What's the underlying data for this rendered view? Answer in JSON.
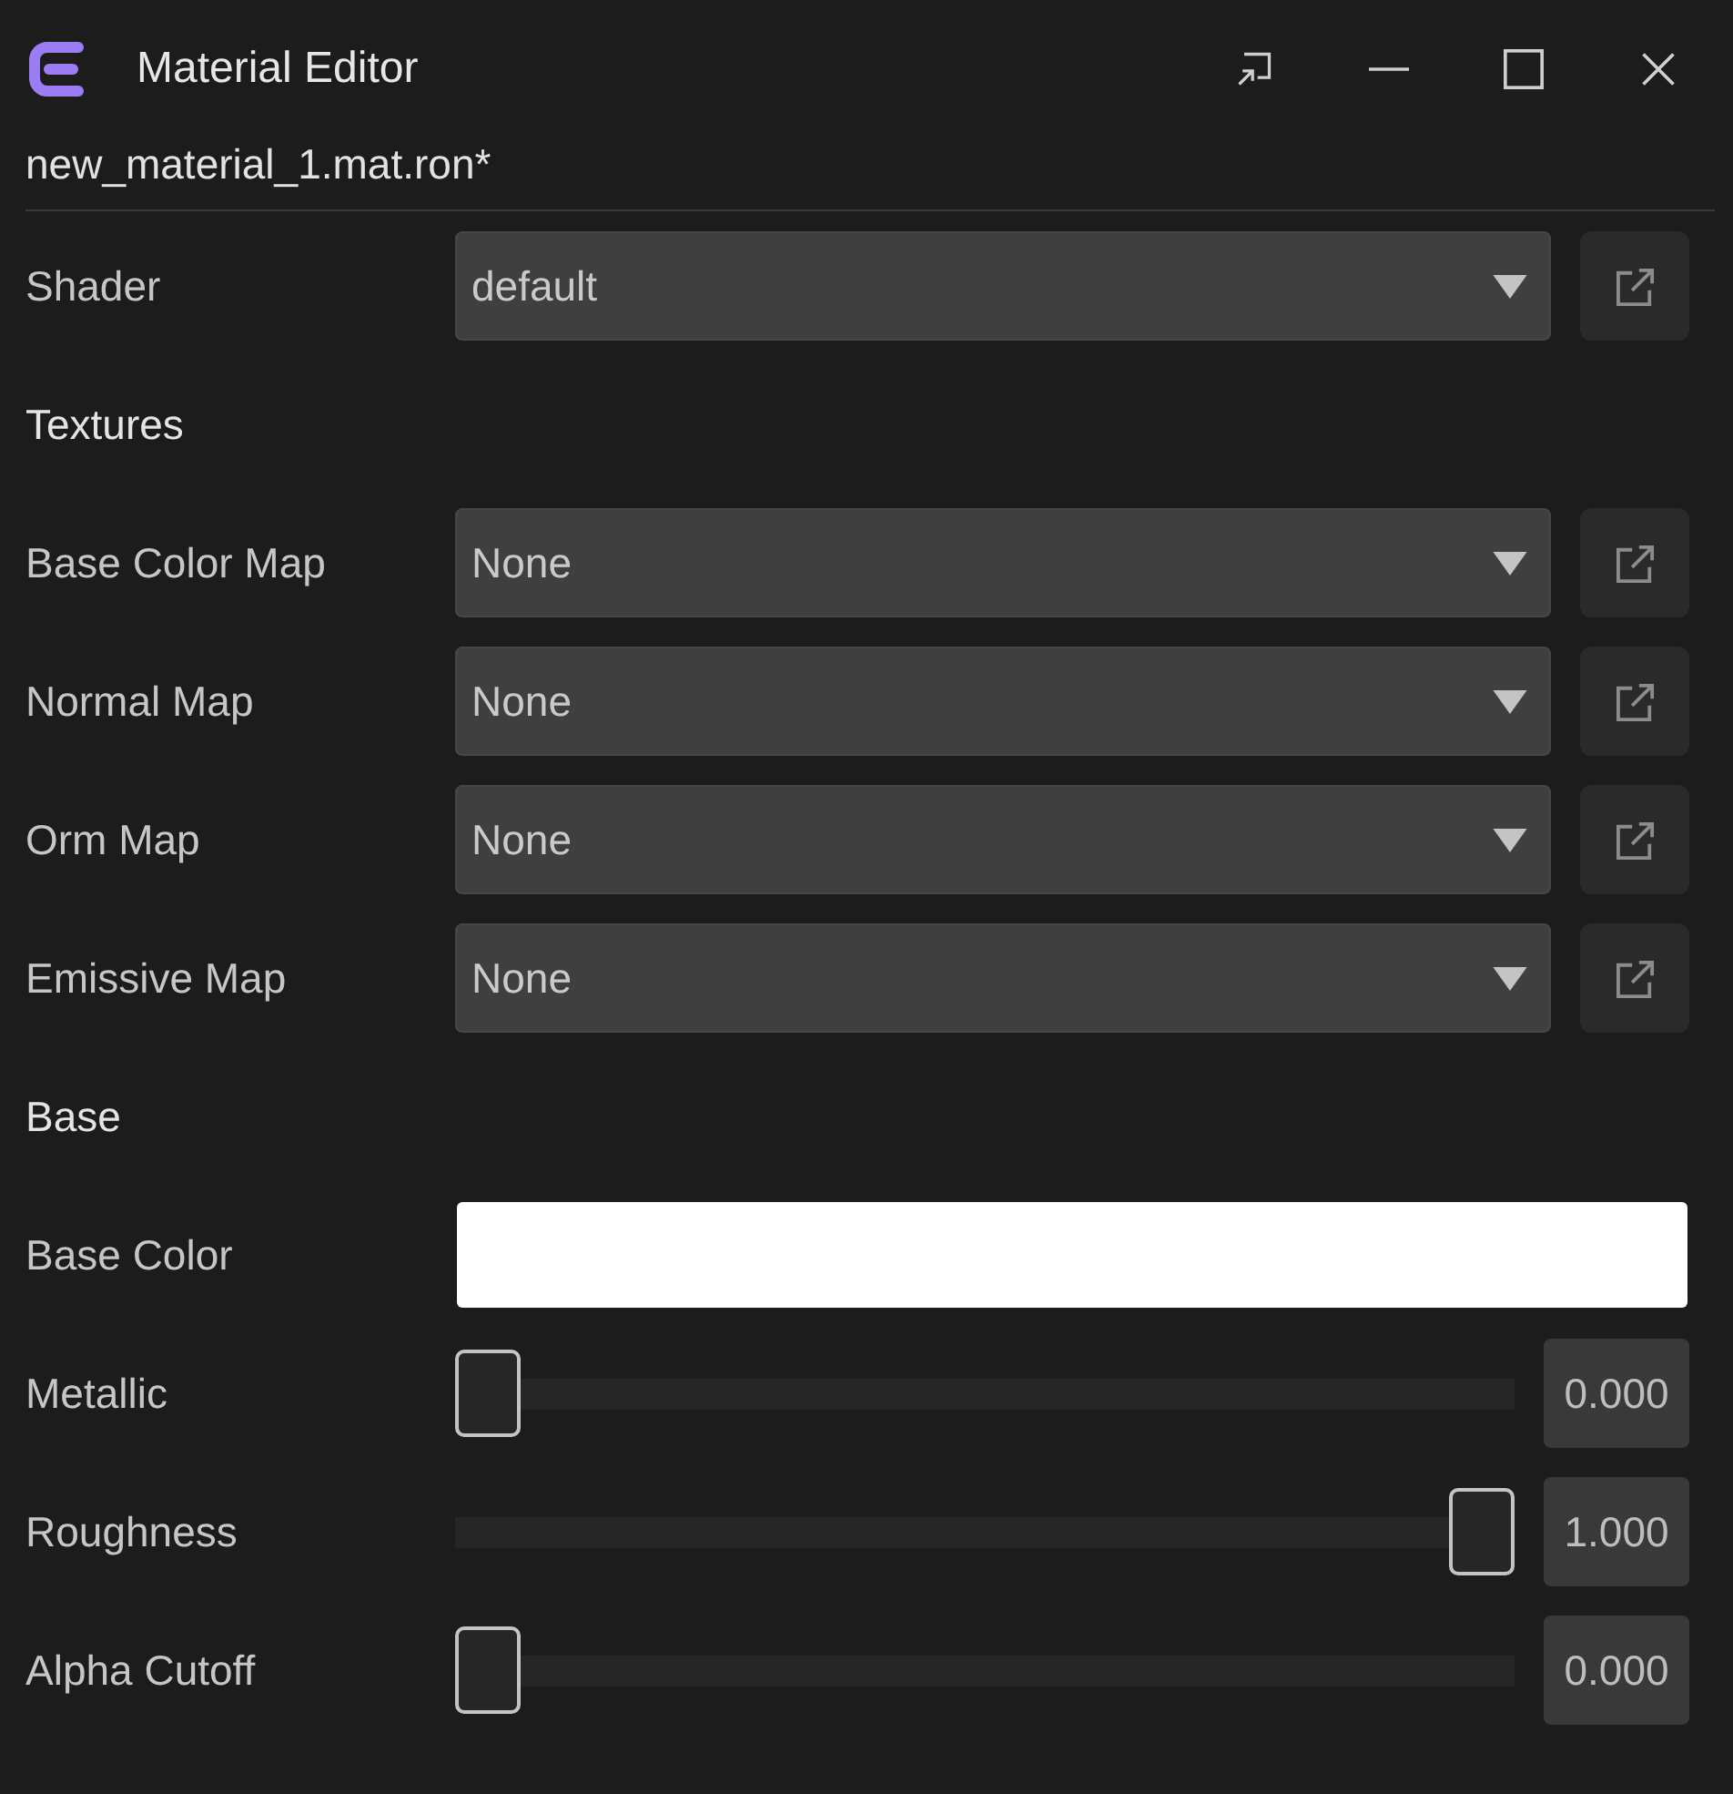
{
  "window": {
    "title": "Material Editor",
    "file": "new_material_1.mat.ron*"
  },
  "rows": [
    {
      "kind": "dropdown",
      "label": "Shader",
      "value": "default"
    },
    {
      "kind": "heading",
      "label": "Textures"
    },
    {
      "kind": "dropdown",
      "label": "Base Color Map",
      "value": "None"
    },
    {
      "kind": "dropdown",
      "label": "Normal Map",
      "value": "None"
    },
    {
      "kind": "dropdown",
      "label": "Orm Map",
      "value": "None"
    },
    {
      "kind": "dropdown",
      "label": "Emissive Map",
      "value": "None"
    },
    {
      "kind": "heading",
      "label": "Base"
    },
    {
      "kind": "color",
      "label": "Base Color",
      "color": "#ffffff"
    },
    {
      "kind": "slider",
      "label": "Metallic",
      "level": 0,
      "reading": "0.000"
    },
    {
      "kind": "slider",
      "label": "Roughness",
      "level": 1,
      "reading": "1.000"
    },
    {
      "kind": "slider",
      "label": "Alpha Cutoff",
      "level": 0,
      "reading": "0.000"
    }
  ]
}
